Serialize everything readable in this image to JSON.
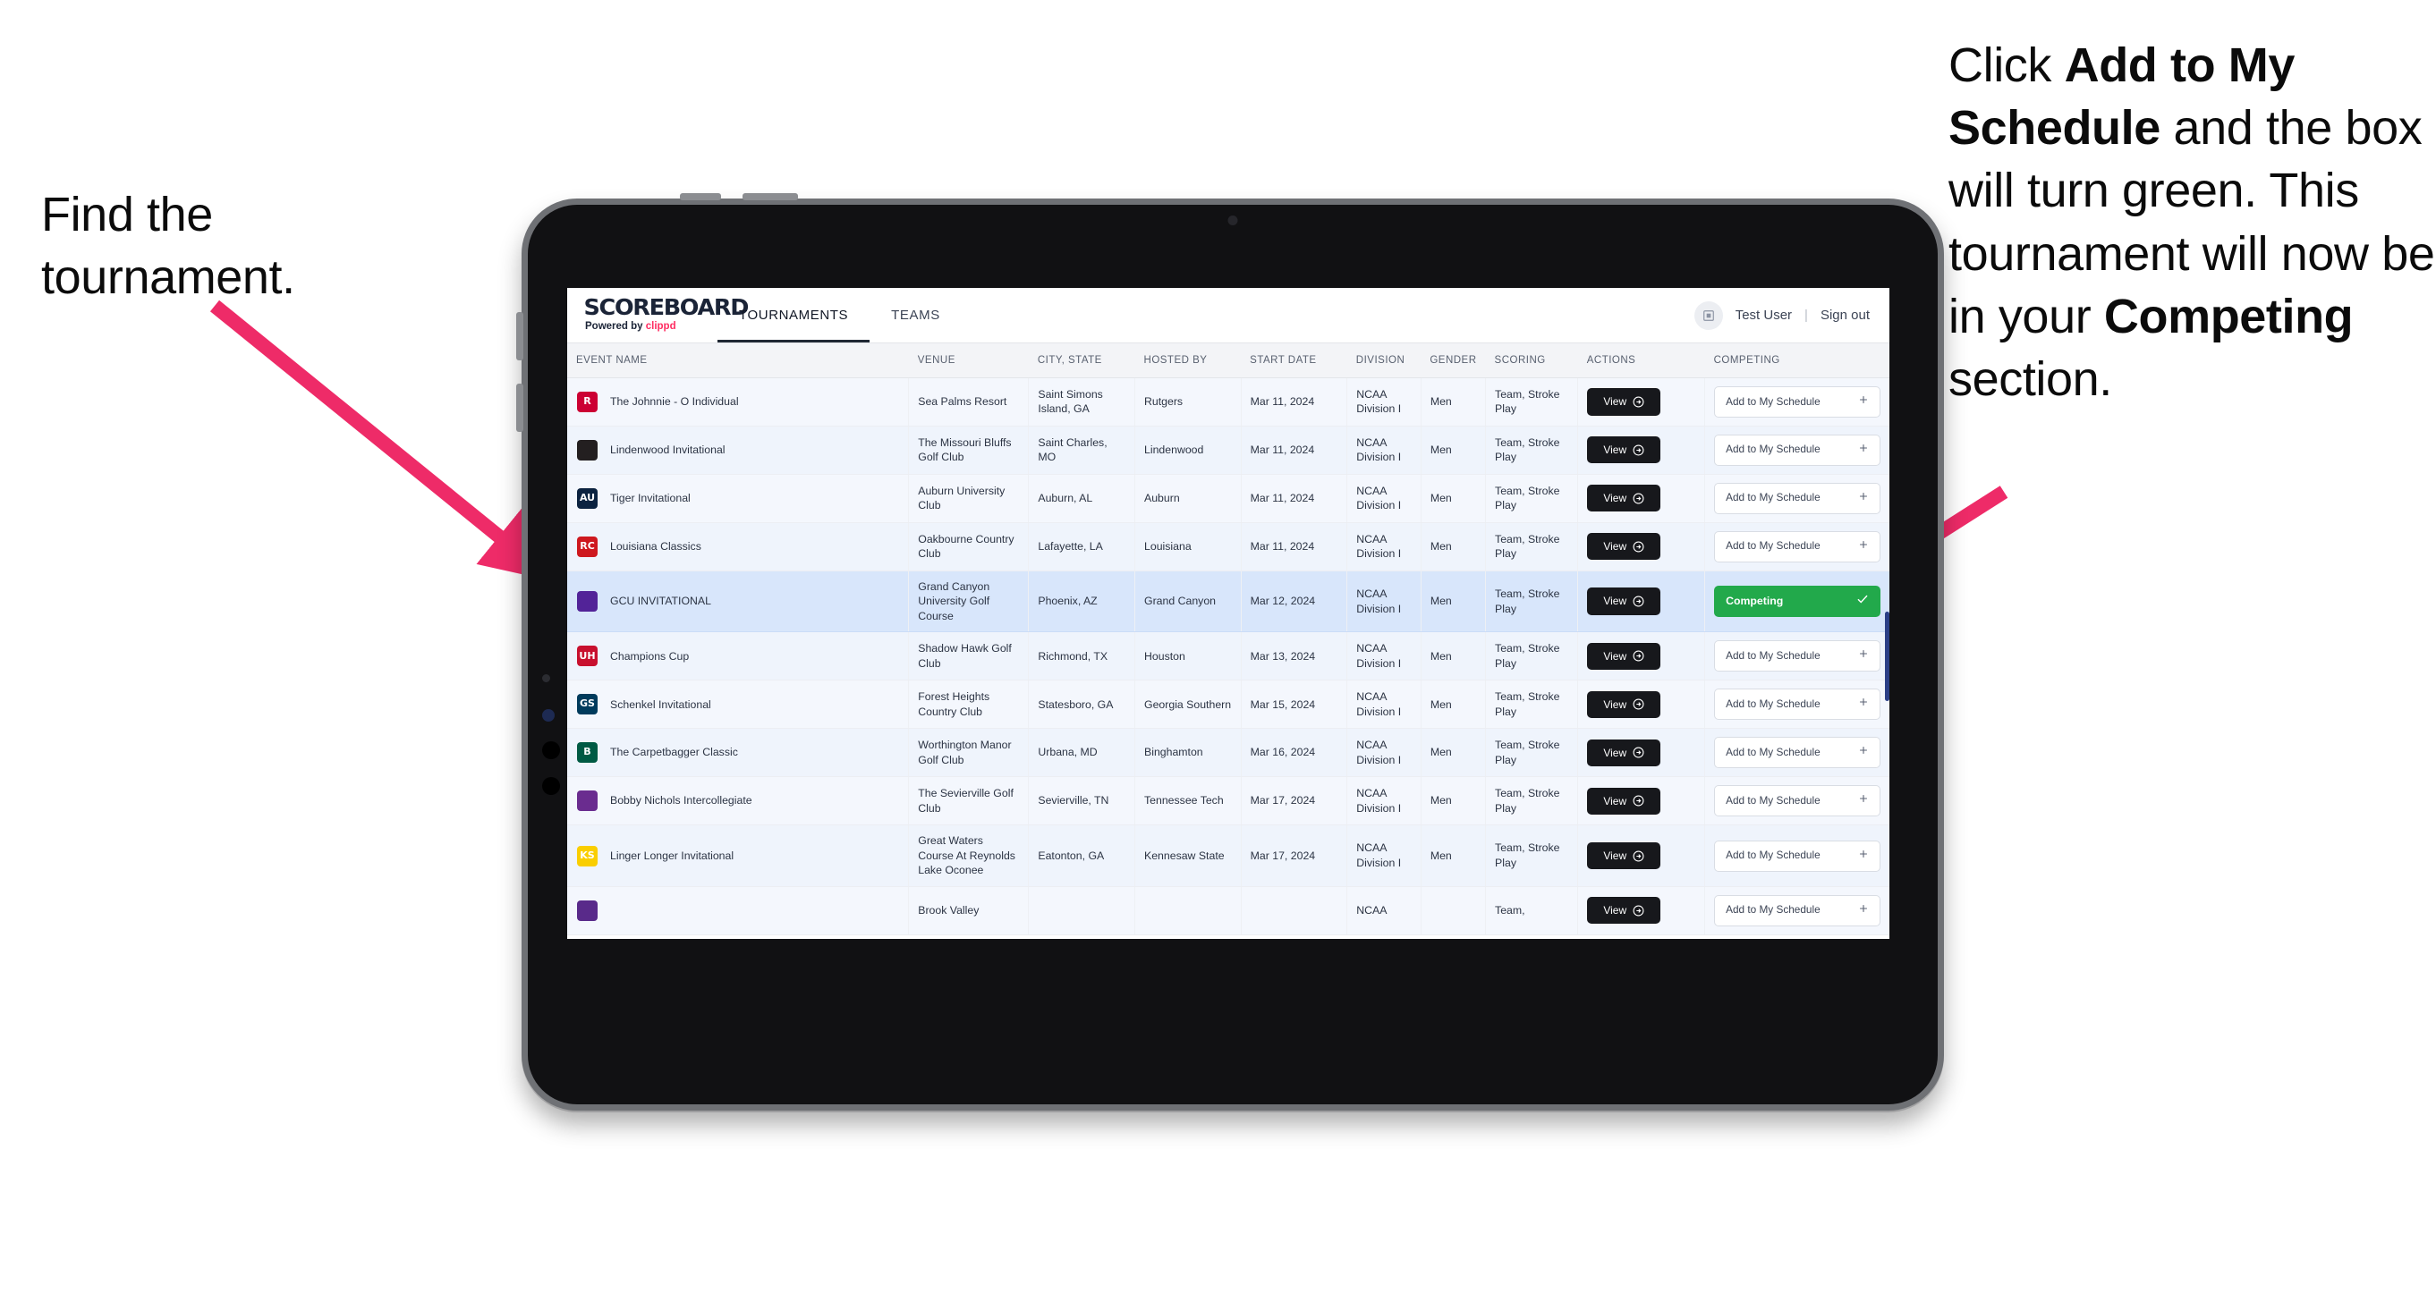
{
  "annotations": {
    "left": "Find the tournament.",
    "right_parts": [
      {
        "text": "Click ",
        "bold": false
      },
      {
        "text": "Add to My Schedule",
        "bold": true
      },
      {
        "text": " and the box will turn green. This tournament will now be in your ",
        "bold": false
      },
      {
        "text": "Competing",
        "bold": true
      },
      {
        "text": " section.",
        "bold": false
      }
    ],
    "arrow_color": "#ee2b68"
  },
  "app": {
    "brand": {
      "name": "SCOREBOARD",
      "tagline_prefix": "Powered by ",
      "tagline_brand": "clippd"
    },
    "tabs": [
      {
        "label": "TOURNAMENTS",
        "active": true
      },
      {
        "label": "TEAMS",
        "active": false
      }
    ],
    "user": {
      "name": "Test User",
      "separator": "|",
      "sign_out": "Sign out",
      "avatar_icon": "user-avatar-icon"
    }
  },
  "table": {
    "columns": [
      "EVENT NAME",
      "VENUE",
      "CITY, STATE",
      "HOSTED BY",
      "START DATE",
      "DIVISION",
      "GENDER",
      "SCORING",
      "ACTIONS",
      "COMPETING"
    ],
    "view_label": "View",
    "add_label": "Add to My Schedule",
    "add_icon": "plus-icon",
    "competing_label": "Competing",
    "competing_icon": "check-icon",
    "rows": [
      {
        "logo": "rutgers-logo",
        "logo_color": "#cc0033",
        "logo_text": "R",
        "event": "The Johnnie - O Individual",
        "venue": "Sea Palms Resort",
        "city": "Saint Simons Island, GA",
        "host": "Rutgers",
        "date": "Mar 11, 2024",
        "division": "NCAA Division I",
        "gender": "Men",
        "scoring": "Team, Stroke Play",
        "competing": false
      },
      {
        "logo": "lindenwood-logo",
        "logo_color": "#231f20",
        "logo_text": "",
        "event": "Lindenwood Invitational",
        "venue": "The Missouri Bluffs Golf Club",
        "city": "Saint Charles, MO",
        "host": "Lindenwood",
        "date": "Mar 11, 2024",
        "division": "NCAA Division I",
        "gender": "Men",
        "scoring": "Team, Stroke Play",
        "competing": false
      },
      {
        "logo": "auburn-logo",
        "logo_color": "#0c2340",
        "logo_text": "AU",
        "event": "Tiger Invitational",
        "venue": "Auburn University Club",
        "city": "Auburn, AL",
        "host": "Auburn",
        "date": "Mar 11, 2024",
        "division": "NCAA Division I",
        "gender": "Men",
        "scoring": "Team, Stroke Play",
        "competing": false
      },
      {
        "logo": "louisiana-logo",
        "logo_color": "#ce181e",
        "logo_text": "RC",
        "event": "Louisiana Classics",
        "venue": "Oakbourne Country Club",
        "city": "Lafayette, LA",
        "host": "Louisiana",
        "date": "Mar 11, 2024",
        "division": "NCAA Division I",
        "gender": "Men",
        "scoring": "Team, Stroke Play",
        "competing": false
      },
      {
        "logo": "grand-canyon-logo",
        "logo_color": "#522398",
        "logo_text": "",
        "event": "GCU INVITATIONAL",
        "venue": "Grand Canyon University Golf Course",
        "city": "Phoenix, AZ",
        "host": "Grand Canyon",
        "date": "Mar 12, 2024",
        "division": "NCAA Division I",
        "gender": "Men",
        "scoring": "Team, Stroke Play",
        "competing": true
      },
      {
        "logo": "houston-logo",
        "logo_color": "#c8102e",
        "logo_text": "UH",
        "event": "Champions Cup",
        "venue": "Shadow Hawk Golf Club",
        "city": "Richmond, TX",
        "host": "Houston",
        "date": "Mar 13, 2024",
        "division": "NCAA Division I",
        "gender": "Men",
        "scoring": "Team, Stroke Play",
        "competing": false
      },
      {
        "logo": "georgia-southern-logo",
        "logo_color": "#003b5c",
        "logo_text": "GS",
        "event": "Schenkel Invitational",
        "venue": "Forest Heights Country Club",
        "city": "Statesboro, GA",
        "host": "Georgia Southern",
        "date": "Mar 15, 2024",
        "division": "NCAA Division I",
        "gender": "Men",
        "scoring": "Team, Stroke Play",
        "competing": false
      },
      {
        "logo": "binghamton-logo",
        "logo_color": "#005a43",
        "logo_text": "B",
        "event": "The Carpetbagger Classic",
        "venue": "Worthington Manor Golf Club",
        "city": "Urbana, MD",
        "host": "Binghamton",
        "date": "Mar 16, 2024",
        "division": "NCAA Division I",
        "gender": "Men",
        "scoring": "Team, Stroke Play",
        "competing": false
      },
      {
        "logo": "tennessee-tech-logo",
        "logo_color": "#6a2c8f",
        "logo_text": "",
        "event": "Bobby Nichols Intercollegiate",
        "venue": "The Sevierville Golf Club",
        "city": "Sevierville, TN",
        "host": "Tennessee Tech",
        "date": "Mar 17, 2024",
        "division": "NCAA Division I",
        "gender": "Men",
        "scoring": "Team, Stroke Play",
        "competing": false
      },
      {
        "logo": "kennesaw-state-logo",
        "logo_color": "#face00",
        "logo_text": "KS",
        "event": "Linger Longer Invitational",
        "venue": "Great Waters Course At Reynolds Lake Oconee",
        "city": "Eatonton, GA",
        "host": "Kennesaw State",
        "date": "Mar 17, 2024",
        "division": "NCAA Division I",
        "gender": "Men",
        "scoring": "Team, Stroke Play",
        "competing": false
      },
      {
        "logo": "east-carolina-logo",
        "logo_color": "#592a8a",
        "logo_text": "",
        "event": "",
        "venue": "Brook Valley",
        "city": "",
        "host": "",
        "date": "",
        "division": "NCAA",
        "gender": "",
        "scoring": "Team,",
        "competing": false,
        "clipped": true
      }
    ]
  }
}
